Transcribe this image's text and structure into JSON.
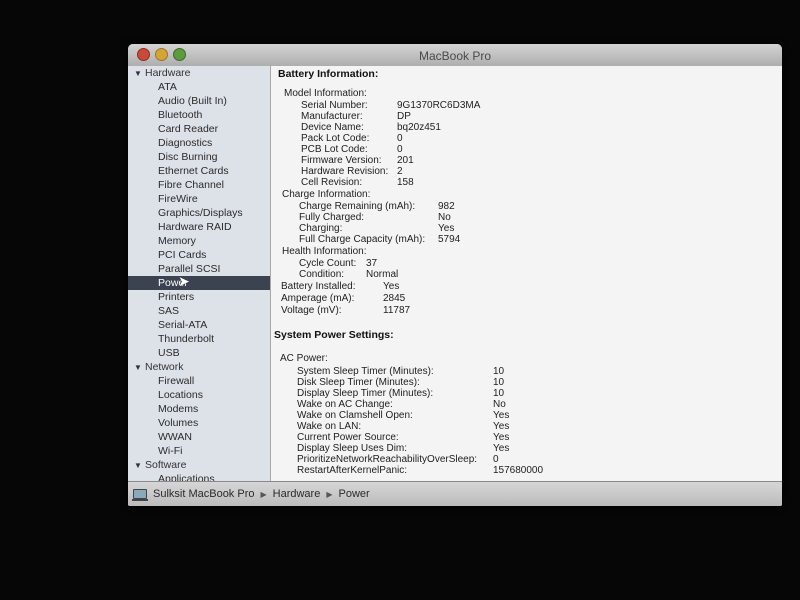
{
  "window": {
    "title": "MacBook Pro"
  },
  "sidebar": {
    "groups": [
      {
        "label": "Hardware",
        "items": [
          "ATA",
          "Audio (Built In)",
          "Bluetooth",
          "Card Reader",
          "Diagnostics",
          "Disc Burning",
          "Ethernet Cards",
          "Fibre Channel",
          "FireWire",
          "Graphics/Displays",
          "Hardware RAID",
          "Memory",
          "PCI Cards",
          "Parallel SCSI",
          "Power",
          "Printers",
          "SAS",
          "Serial-ATA",
          "Thunderbolt",
          "USB"
        ]
      },
      {
        "label": "Network",
        "items": [
          "Firewall",
          "Locations",
          "Modems",
          "Volumes",
          "WWAN",
          "Wi-Fi"
        ]
      },
      {
        "label": "Software",
        "items": [
          "Applications"
        ]
      }
    ],
    "selected": "Power"
  },
  "battery": {
    "title": "Battery Information:",
    "model_title": "Model Information:",
    "model": [
      [
        "Serial Number:",
        "9G1370RC6D3MA"
      ],
      [
        "Manufacturer:",
        "DP"
      ],
      [
        "Device Name:",
        "bq20z451"
      ],
      [
        "Pack Lot Code:",
        "0"
      ],
      [
        "PCB Lot Code:",
        "0"
      ],
      [
        "Firmware Version:",
        "201"
      ],
      [
        "Hardware Revision:",
        "2"
      ],
      [
        "Cell Revision:",
        "158"
      ]
    ],
    "charge_title": "Charge Information:",
    "charge": [
      [
        "Charge Remaining (mAh):",
        "982"
      ],
      [
        "Fully Charged:",
        "No"
      ],
      [
        "Charging:",
        "Yes"
      ],
      [
        "Full Charge Capacity (mAh):",
        "5794"
      ]
    ],
    "health_title": "Health Information:",
    "health": [
      [
        "Cycle Count:",
        "37"
      ],
      [
        "Condition:",
        "Normal"
      ]
    ],
    "misc": [
      [
        "Battery Installed:",
        "Yes"
      ],
      [
        "Amperage (mA):",
        "2845"
      ],
      [
        "Voltage (mV):",
        "11787"
      ]
    ]
  },
  "power": {
    "title": "System Power Settings:",
    "ac_title": "AC Power:",
    "ac": [
      [
        "System Sleep Timer (Minutes):",
        "10"
      ],
      [
        "Disk Sleep Timer (Minutes):",
        "10"
      ],
      [
        "Display Sleep Timer (Minutes):",
        "10"
      ],
      [
        "Wake on AC Change:",
        "No"
      ],
      [
        "Wake on Clamshell Open:",
        "Yes"
      ],
      [
        "Wake on LAN:",
        "Yes"
      ],
      [
        "Current Power Source:",
        "Yes"
      ],
      [
        "Display Sleep Uses Dim:",
        "Yes"
      ],
      [
        "PrioritizeNetworkReachabilityOverSleep:",
        "0"
      ],
      [
        "RestartAfterKernelPanic:",
        "157680000"
      ]
    ]
  },
  "pathbar": [
    "Sulksit MacBook Pro",
    "Hardware",
    "Power"
  ]
}
